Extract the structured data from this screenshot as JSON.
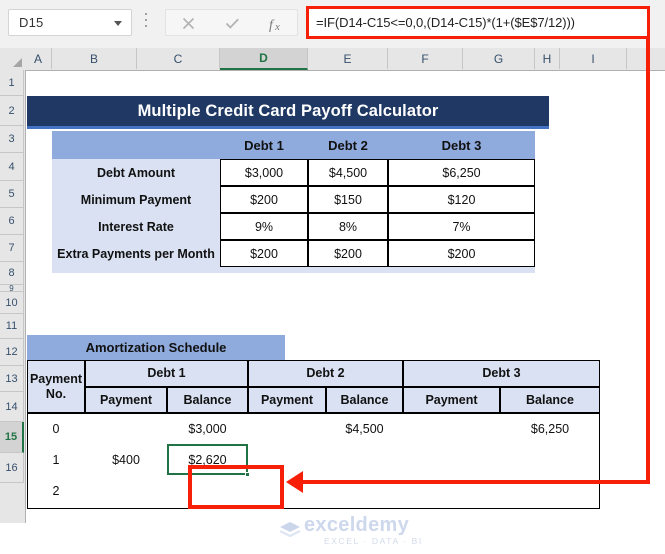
{
  "formula_bar": {
    "name_box_value": "D15",
    "formula": "=IF(D14-C15<=0,0,(D14-C15)*(1+($E$7/12)))",
    "cancel_icon": "close-icon",
    "enter_icon": "check-icon",
    "fx_icon": "function-icon",
    "dropdown_icon": "chevron-down-icon",
    "kebab_icon": "more-options-icon"
  },
  "grid": {
    "columns": [
      "A",
      "B",
      "C",
      "D",
      "E",
      "F",
      "G",
      "H",
      "I"
    ],
    "selected_column": "D",
    "rows": [
      "1",
      "2",
      "3",
      "4",
      "5",
      "6",
      "7",
      "8",
      "9",
      "10",
      "11",
      "12",
      "13",
      "14",
      "15",
      "16"
    ],
    "selected_row": "15"
  },
  "title": {
    "text": "Multiple Credit Card Payoff Calculator",
    "bg_color": "#1F3864",
    "underline_color": "#4472C4"
  },
  "debt_table": {
    "header_bg": "#8FAADC",
    "label_bg": "#D9E1F2",
    "column_headers": [
      "Debt 1",
      "Debt 2",
      "Debt 3"
    ],
    "rows": [
      {
        "label": "Debt Amount",
        "values": [
          "$3,000",
          "$4,500",
          "$6,250"
        ]
      },
      {
        "label": "Minimum Payment",
        "values": [
          "$200",
          "$150",
          "$120"
        ]
      },
      {
        "label": "Interest Rate",
        "values": [
          "9%",
          "8%",
          "7%"
        ]
      },
      {
        "label": "Extra Payments per Month",
        "values": [
          "$200",
          "$200",
          "$200"
        ]
      }
    ]
  },
  "amortization": {
    "banner": "Amortization Schedule",
    "banner_bg": "#8FAADC",
    "header_bg": "#D9E1F2",
    "first_col_header_line1": "Payment",
    "first_col_header_line2": "No.",
    "debt_groups": [
      "Debt 1",
      "Debt 2",
      "Debt 3"
    ],
    "sub_headers": [
      "Payment",
      "Balance"
    ],
    "rows": [
      {
        "no": "0",
        "d1_payment": "",
        "d1_balance": "$3,000",
        "d2_payment": "",
        "d2_balance": "$4,500",
        "d3_payment": "",
        "d3_balance": "$6,250"
      },
      {
        "no": "1",
        "d1_payment": "$400",
        "d1_balance": "$2,620",
        "d2_payment": "",
        "d2_balance": "",
        "d3_payment": "",
        "d3_balance": ""
      },
      {
        "no": "2",
        "d1_payment": "",
        "d1_balance": "",
        "d2_payment": "",
        "d2_balance": "",
        "d3_payment": "",
        "d3_balance": ""
      }
    ]
  },
  "annotation": {
    "color": "#F81F08",
    "description": "Red callout connecting the formula bar to cell D15"
  },
  "watermark": {
    "word": "exceldemy",
    "subtitle": "EXCEL · DATA · BI"
  }
}
